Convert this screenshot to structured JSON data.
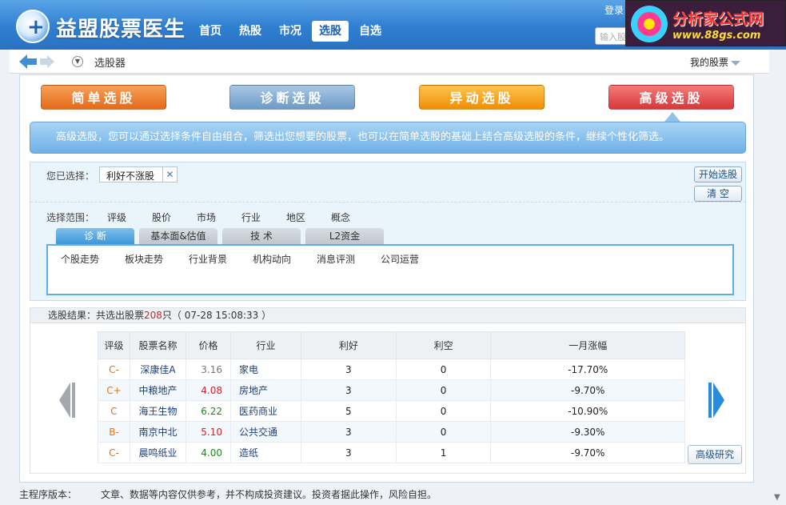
{
  "app": {
    "name": "益盟股票医生"
  },
  "nav": {
    "items": [
      "首页",
      "热股",
      "市况",
      "选股",
      "自选"
    ],
    "active": "选股"
  },
  "header": {
    "login": "登录",
    "search_placeholder": "输入股票"
  },
  "watermark": {
    "title": "分析家公式网",
    "url": "www.88gs.com"
  },
  "breadcrumb": {
    "page": "选股器",
    "my_stocks": "我的股票"
  },
  "mode_tabs": [
    "简单选股",
    "诊断选股",
    "异动选股",
    "高级选股"
  ],
  "intro_text": "高级选股，您可以通过选择条件自由组合，筛选出您想要的股票，也可以在简单选股的基础上结合高级选股的条件，继续个性化筛选。",
  "selection": {
    "label": "您已选择：",
    "chip": "利好不涨股",
    "start_button": "开始选股",
    "clear_button": "清 空"
  },
  "range": {
    "label": "选择范围：",
    "items": [
      "评级",
      "股价",
      "市场",
      "行业",
      "地区",
      "概念"
    ]
  },
  "sub_tabs": {
    "items": [
      "诊 断",
      "基本面&估值",
      "技 术",
      "L2资金"
    ],
    "active": 0
  },
  "sub_items": [
    "个股走势",
    "板块走势",
    "行业背景",
    "机构动向",
    "消息评测",
    "公司运营"
  ],
  "result": {
    "prefix": "选股结果：共选出股票",
    "count": "208",
    "suffix": "只（ 07-28 15:08:33 ）"
  },
  "table": {
    "headers": [
      "评级",
      "股票名称",
      "价格",
      "行业",
      "利好",
      "利空",
      "一月涨幅"
    ],
    "rows": [
      {
        "rating": "C-",
        "name": "深康佳A",
        "price": "3.16",
        "price_color": "gray",
        "industry": "家电",
        "good": "3",
        "bad": "0",
        "change": "-17.70%"
      },
      {
        "rating": "C+",
        "name": "中粮地产",
        "price": "4.08",
        "price_color": "red",
        "industry": "房地产",
        "good": "3",
        "bad": "0",
        "change": "-9.70%"
      },
      {
        "rating": "C",
        "name": "海王生物",
        "price": "6.22",
        "price_color": "green",
        "industry": "医药商业",
        "good": "5",
        "bad": "0",
        "change": "-10.90%"
      },
      {
        "rating": "B-",
        "name": "南京中北",
        "price": "5.10",
        "price_color": "red",
        "industry": "公共交通",
        "good": "3",
        "bad": "0",
        "change": "-9.30%"
      },
      {
        "rating": "C-",
        "name": "晨鸣纸业",
        "price": "4.00",
        "price_color": "green",
        "industry": "造纸",
        "good": "3",
        "bad": "1",
        "change": "-9.70%"
      }
    ]
  },
  "research_button": "高级研究",
  "footer": {
    "version_label": "主程序版本：",
    "disclaimer": "文章、数据等内容仅供参考，并不构成投资建议。投资者据此操作，风险自担。"
  }
}
